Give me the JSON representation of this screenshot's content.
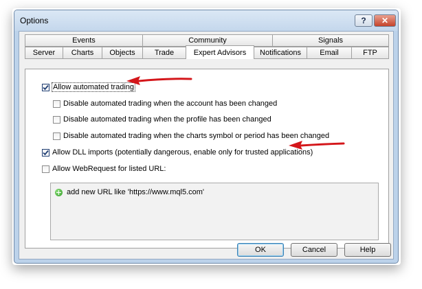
{
  "window": {
    "title": "Options",
    "help_glyph": "?",
    "close_glyph": "✕"
  },
  "tabs": {
    "top_row": [
      {
        "label": "Events"
      },
      {
        "label": "Community"
      },
      {
        "label": "Signals"
      }
    ],
    "bottom_row": [
      {
        "label": "Server"
      },
      {
        "label": "Charts"
      },
      {
        "label": "Objects"
      },
      {
        "label": "Trade"
      },
      {
        "label": "Expert Advisors",
        "active": true
      },
      {
        "label": "Notifications"
      },
      {
        "label": "Email"
      },
      {
        "label": "FTP"
      }
    ]
  },
  "options": {
    "allow_automated_trading": {
      "label": "Allow automated trading",
      "checked": true
    },
    "disable_account_changed": {
      "label": "Disable automated trading when the account has been changed",
      "checked": false
    },
    "disable_profile_changed": {
      "label": "Disable automated trading when the profile has been changed",
      "checked": false
    },
    "disable_symbol_changed": {
      "label": "Disable automated trading when the charts symbol or period has been changed",
      "checked": false
    },
    "allow_dll_imports": {
      "label": "Allow DLL imports (potentially dangerous, enable only for trusted applications)",
      "checked": true
    },
    "allow_webrequest": {
      "label": "Allow WebRequest for listed URL:",
      "checked": false
    }
  },
  "url_list": {
    "add_text": "add new URL like 'https://www.mql5.com'"
  },
  "buttons": {
    "ok": "OK",
    "cancel": "Cancel",
    "help": "Help"
  },
  "colors": {
    "annotation_arrow": "#d4161a",
    "checkmark": "#1f3e73",
    "window_frame": "#bcd2ea"
  }
}
